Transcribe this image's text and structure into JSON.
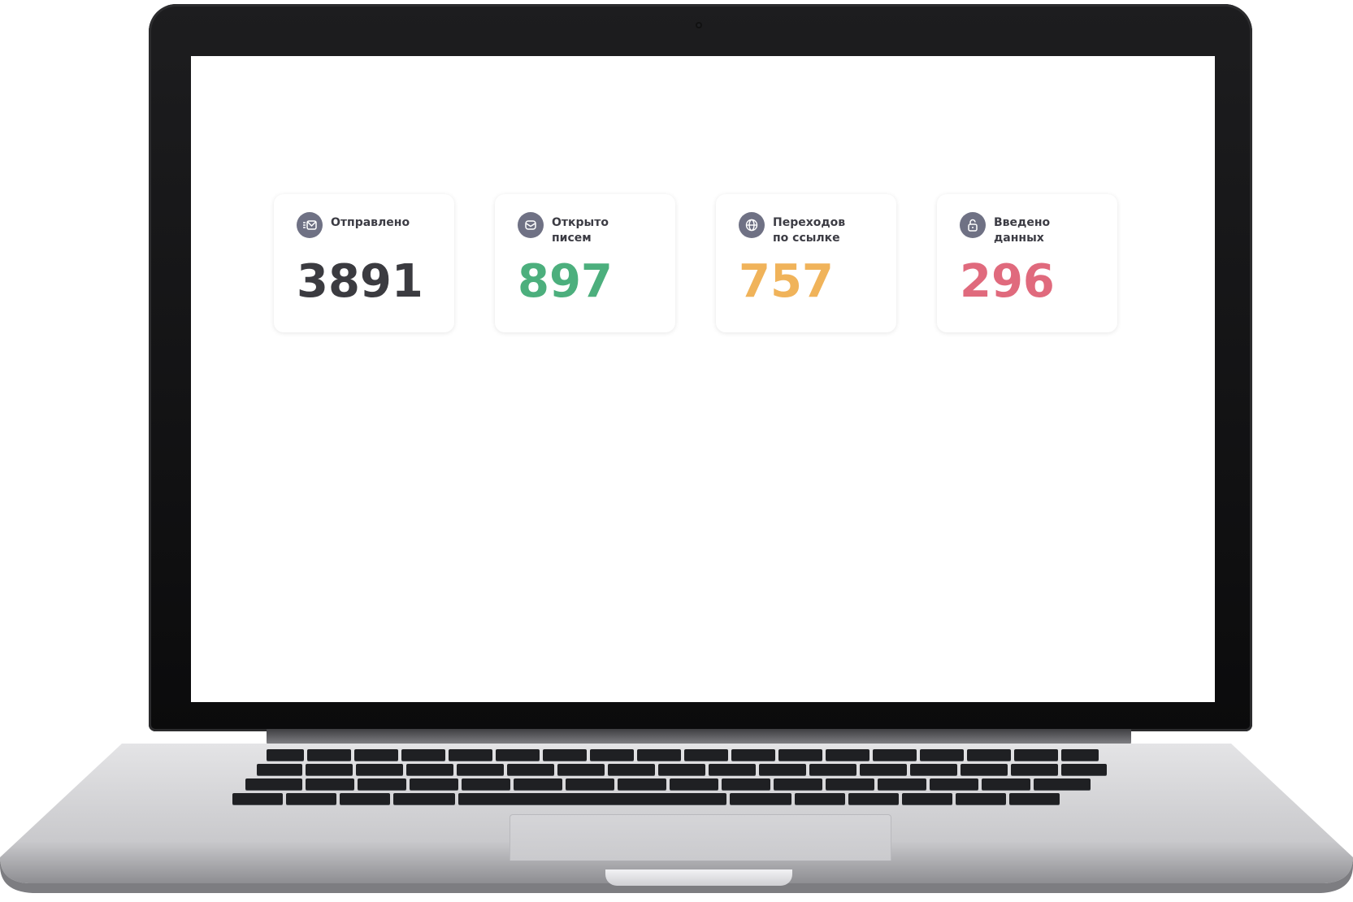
{
  "stats": [
    {
      "icon": "mail-sent-icon",
      "label": "Отправлено",
      "value": "3891",
      "color": "#3b3b40"
    },
    {
      "icon": "envelope-open-icon",
      "label": "Открыто\nписем",
      "value": "897",
      "color": "#4caf7d"
    },
    {
      "icon": "globe-icon",
      "label": "Переходов\nпо ссылке",
      "value": "757",
      "color": "#f0b35a"
    },
    {
      "icon": "lock-icon",
      "label": "Введено\nданных",
      "value": "296",
      "color": "#e06a7d"
    }
  ]
}
